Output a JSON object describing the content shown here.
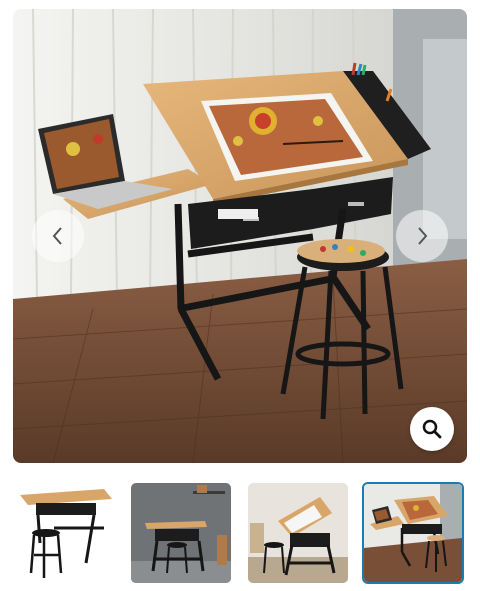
{
  "gallery": {
    "main_image_alt": "",
    "prev_icon": "chevron-left-icon",
    "next_icon": "chevron-right-icon",
    "zoom_icon": "magnifier-icon",
    "selected_index": 3,
    "thumbnails": [
      {
        "icon": "desk-white-background"
      },
      {
        "icon": "desk-grey-room"
      },
      {
        "icon": "desk-tilted-light-room"
      },
      {
        "icon": "desk-with-laptop"
      }
    ]
  },
  "colors": {
    "selected_border": "#1e7bb0",
    "desk_top": "#d9a66a",
    "frame": "#1a1a1a",
    "floor": "#6b4632"
  }
}
